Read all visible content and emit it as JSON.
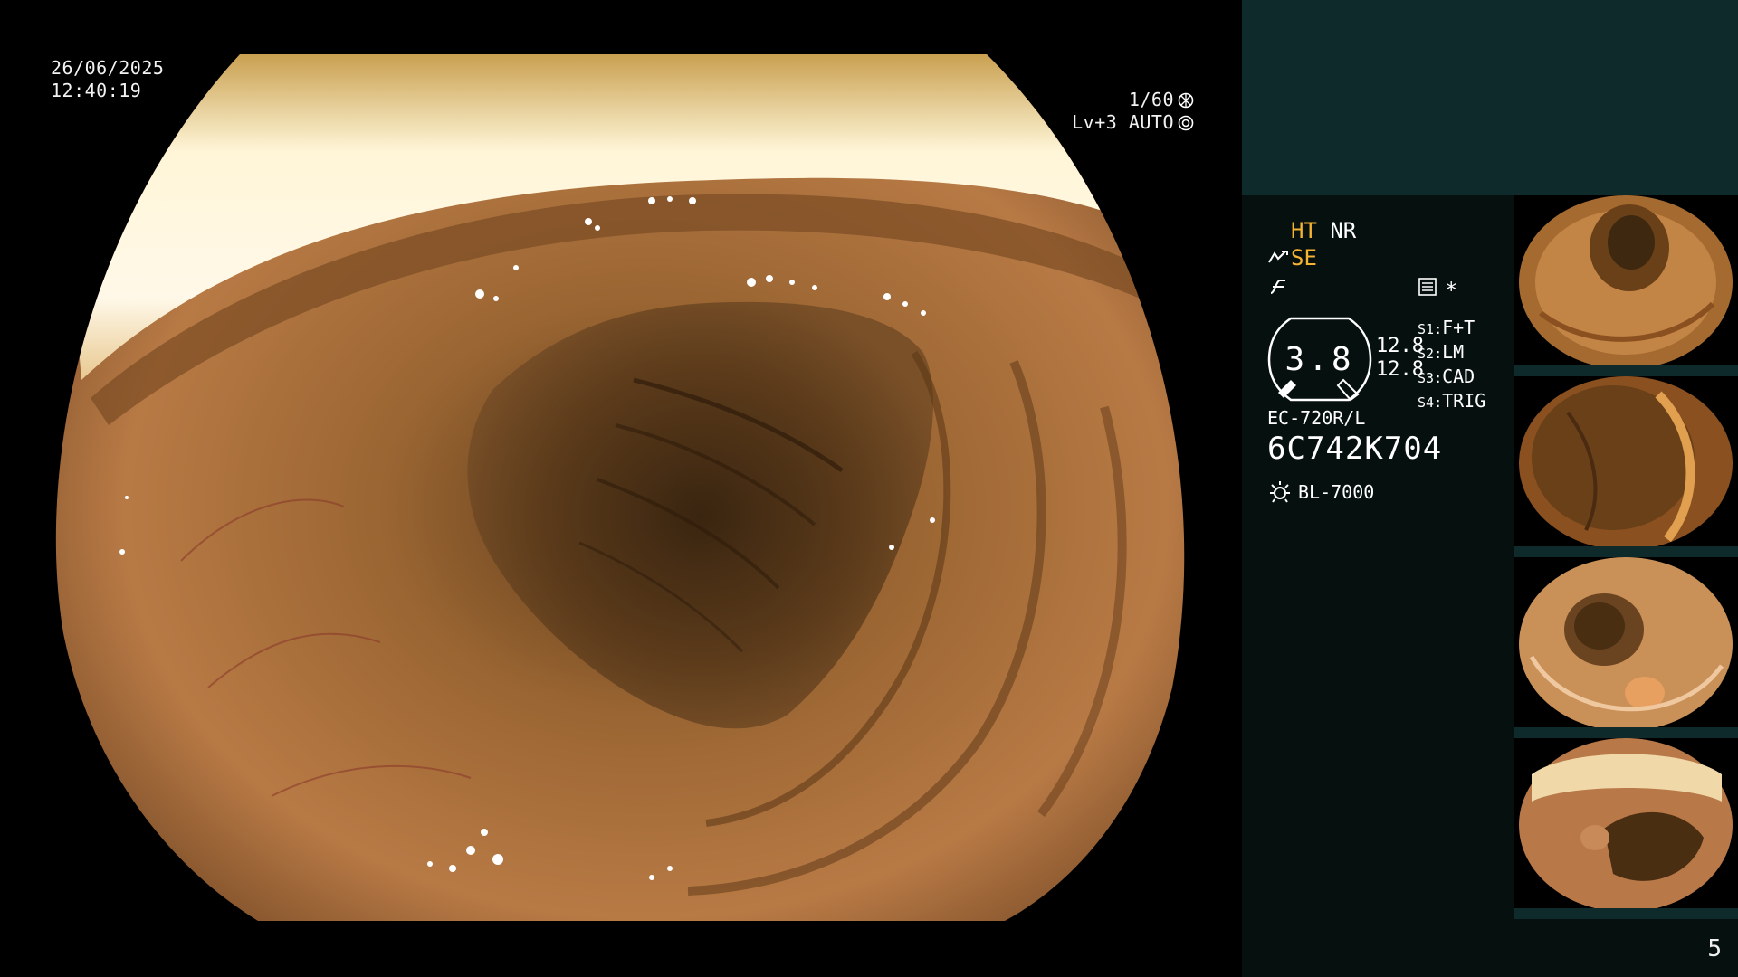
{
  "osd": {
    "date": "26/06/2025",
    "time": "12:40:19",
    "shutter": "1/60",
    "iris": "Lv+3 AUTO"
  },
  "panel": {
    "ht": "HT",
    "nr": "NR",
    "se": "SE",
    "gauge_value": "3.8",
    "val1": "12.8",
    "val2": "12.8",
    "switches": [
      {
        "key": "S1",
        "value": "F+T"
      },
      {
        "key": "S2",
        "value": "LM"
      },
      {
        "key": "S3",
        "value": "CAD"
      },
      {
        "key": "S4",
        "value": "TRIG"
      }
    ],
    "scope_model": "EC-720R/L",
    "scope_serial": "6C742K704",
    "light_source": "BL-7000",
    "asterisk": "*",
    "page_number": "5"
  },
  "colors": {
    "panel_bg": "#06100f",
    "panel_top": "#0e2a2a",
    "accent_orange": "#f5b233"
  }
}
